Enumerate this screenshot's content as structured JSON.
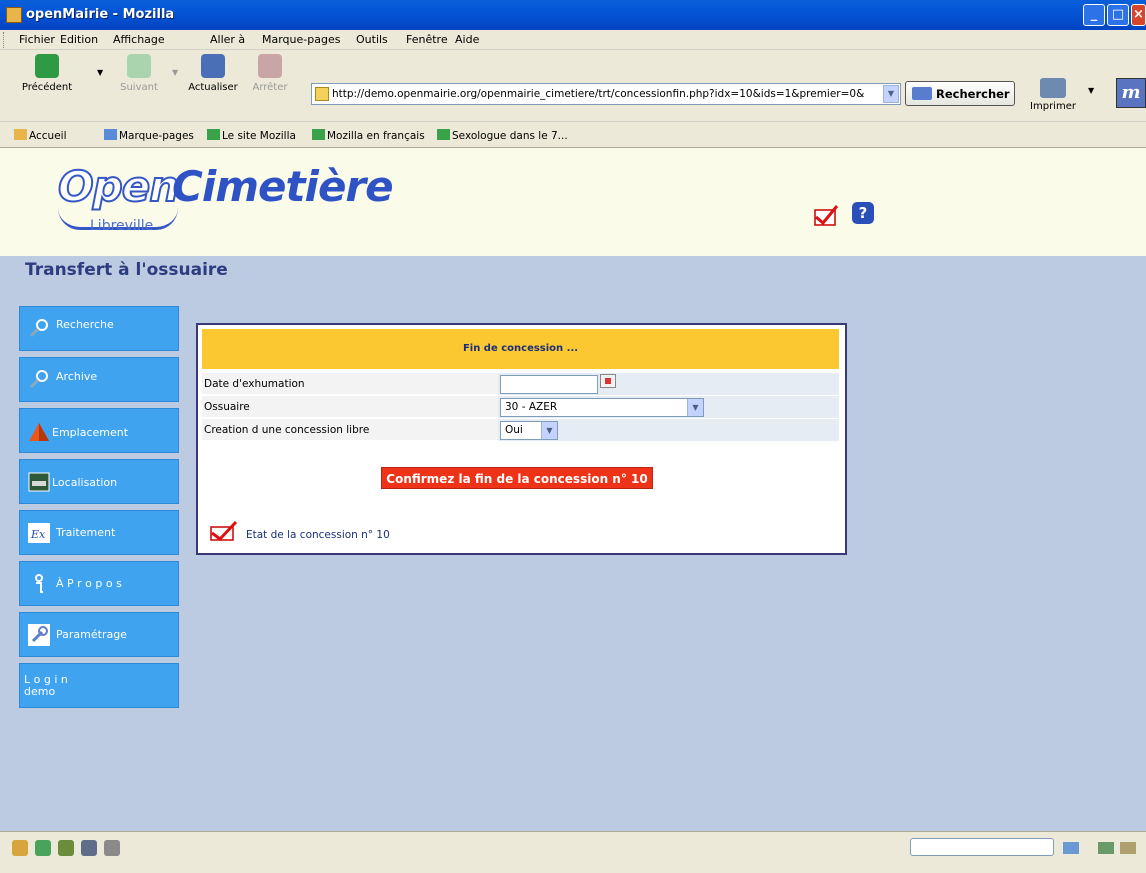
{
  "window": {
    "title": "openMairie - Mozilla"
  },
  "menu": [
    "Fichier",
    "Edition",
    "Affichage",
    "Aller à",
    "Marque-pages",
    "Outils",
    "Fenêtre",
    "Aide"
  ],
  "nav": {
    "back": "Précédent",
    "forward": "Suivant",
    "reload": "Actualiser",
    "stop": "Arrêter",
    "url": "http://demo.openmairie.org/openmairie_cimetiere/trt/concessionfin.php?idx=10&ids=1&premier=0&",
    "search": "Rechercher",
    "print": "Imprimer",
    "brand": "m"
  },
  "bookmarks": [
    "Accueil",
    "Marque-pages",
    "Le site Mozilla",
    "Mozilla en français",
    "Sexologue dans le 7..."
  ],
  "header": {
    "logo_open": "Open",
    "logo_cimetiere": "Cimetière",
    "city": "Libreville",
    "help": "?"
  },
  "page_title": "Transfert à l'ossuaire",
  "sidebar": [
    {
      "label": "Recherche",
      "icon": "search-icon"
    },
    {
      "label": "Archive",
      "icon": "search-icon"
    },
    {
      "label": "Emplacement",
      "icon": "pyramid-icon"
    },
    {
      "label": "Localisation",
      "icon": "street-sign-icon"
    },
    {
      "label": "Traitement",
      "icon": "ex-icon"
    },
    {
      "label": "À P r o p o s",
      "icon": "info-icon"
    },
    {
      "label": "Paramétrage",
      "icon": "wrench-icon"
    },
    {
      "label": "L o g i n",
      "label2": "demo",
      "icon": ""
    }
  ],
  "form": {
    "heading": "Fin de concession ...",
    "date_label": "Date d'exhumation",
    "date_value": "",
    "ossuaire_label": "Ossuaire",
    "ossuaire_value": "30 - AZER",
    "creation_label": "Creation d une concession libre",
    "creation_value": "Oui",
    "confirm_label": "Confirmez la fin de la concession n° 10",
    "etat_label": "Etat de la concession n° 10"
  },
  "colors": {
    "sidebar": "#3fa3f0",
    "page_bg": "#bccbe2",
    "panel_head": "#fcc832",
    "confirm": "#ee3318",
    "title": "#2d3c7f"
  }
}
